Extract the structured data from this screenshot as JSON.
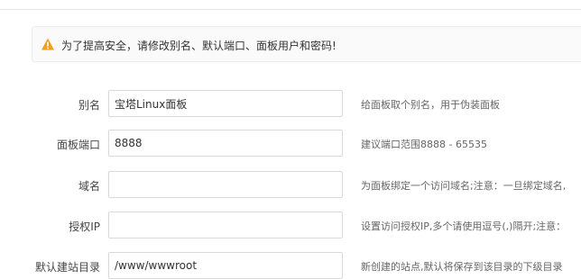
{
  "alert": {
    "icon": "warning-icon",
    "text": "为了提高安全，请修改别名、默认端口、面板用户和密码!",
    "icon_color": "#f0a020"
  },
  "form": {
    "rows": [
      {
        "label": "别名",
        "value": "宝塔Linux面板",
        "placeholder": "",
        "hint": "给面板取个别名，用于伪装面板"
      },
      {
        "label": "面板端口",
        "value": "8888",
        "placeholder": "",
        "hint": "建议端口范围8888 - 65535"
      },
      {
        "label": "域名",
        "value": "",
        "placeholder": "",
        "hint": "为面板绑定一个访问域名;注意：一旦绑定域名,"
      },
      {
        "label": "授权IP",
        "value": "",
        "placeholder": "",
        "hint": "设置访问授权IP,多个请使用逗号(,)隔开;注意："
      },
      {
        "label": "默认建站目录",
        "value": "/www/wwwroot",
        "placeholder": "",
        "hint": "新创建的站点,默认将保存到该目录的下级目录"
      }
    ]
  }
}
